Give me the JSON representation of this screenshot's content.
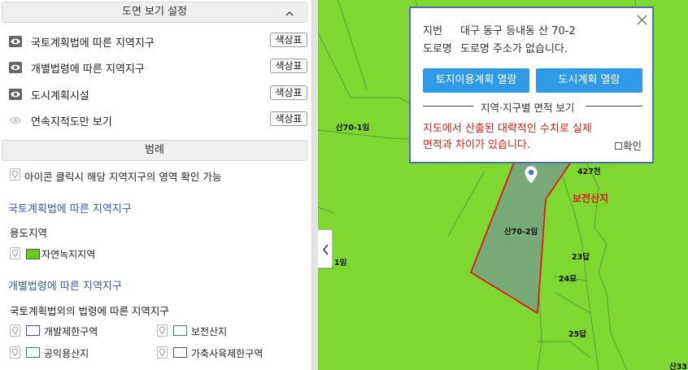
{
  "panel": {
    "view_settings": {
      "title": "도면 보기 설정",
      "rows": [
        {
          "label": "국토계획법에 따른 지역지구",
          "button": "색상표"
        },
        {
          "label": "개별법령에 따른 지역지구",
          "button": "색상표"
        },
        {
          "label": "도시계획시설",
          "button": "색상표"
        },
        {
          "label": "연속지적도만 보기",
          "button": "색상표"
        }
      ]
    },
    "legend": {
      "title": "범례",
      "note": "아이콘 클릭시 해당 지역지구의 영역 확인 가능",
      "national_title": "국토계획법에 따른 지역지구",
      "national_sub": "용도지역",
      "national_items": [
        {
          "label": "자연녹지지역",
          "color": "#66cc1a"
        }
      ],
      "individual_title": "개별법령에 따른 지역지구",
      "individual_sub": "국토계획법외의 법령에 따른 지역지구",
      "individual_items": [
        {
          "label": "개발제한구역",
          "border": "#6a3aa8"
        },
        {
          "label": "보전산지",
          "border": "#2e8a5a"
        },
        {
          "label": "공익용산지",
          "border": "#2e8a5a"
        },
        {
          "label": "가축사육제한구역",
          "border": "#555555"
        }
      ]
    }
  },
  "map": {
    "labels": {
      "parcel_a": "산70-1임",
      "parcel_b": "산70-2임",
      "parcel_c": "427천",
      "parcel_d": "23답",
      "parcel_e": "24묘",
      "parcel_f": "25답",
      "parcel_g": "1임",
      "parcel_h": "산33",
      "zone": "보전산지"
    },
    "colors": {
      "base": "#7fd830",
      "selected_fill": "#77aa77",
      "selected_border": "#e01818"
    }
  },
  "popup": {
    "jibun_label": "지번",
    "jibun_value": "대구 동구 등내동 산 70-2",
    "road_label": "도로명",
    "road_value": "도로명 주소가 없습니다.",
    "btn_land_use": "토지이용계획 열람",
    "btn_city_plan": "도시계획 열람",
    "area_heading": "지역·지구별 면적 보기",
    "warning_line1": "지도에서 산출된 대략적인 수치로 실제",
    "warning_line2": "면적과 차이가 있습니다.",
    "confirm_label": "확인",
    "accent_color": "#2f9be6"
  }
}
